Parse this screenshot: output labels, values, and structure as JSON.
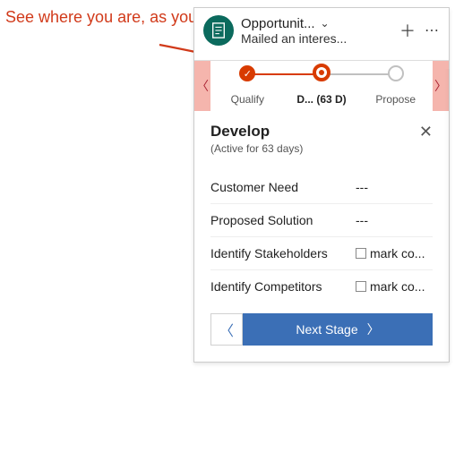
{
  "annotation": "See where you are, as you work on a record",
  "header": {
    "title": "Opportunit...",
    "subtitle": "Mailed an interes..."
  },
  "stages": {
    "items": [
      {
        "label": "Qualify"
      },
      {
        "label": "D...   (63 D)"
      },
      {
        "label": "Propose"
      }
    ]
  },
  "panel": {
    "title": "Develop",
    "active_text": "(Active for 63 days)",
    "fields": [
      {
        "label": "Customer Need",
        "value": "---",
        "checkbox": false
      },
      {
        "label": "Proposed Solution",
        "value": "---",
        "checkbox": false
      },
      {
        "label": "Identify Stakeholders",
        "value": "mark co...",
        "checkbox": true
      },
      {
        "label": "Identify Competitors",
        "value": "mark co...",
        "checkbox": true
      }
    ],
    "next_label": "Next Stage"
  }
}
